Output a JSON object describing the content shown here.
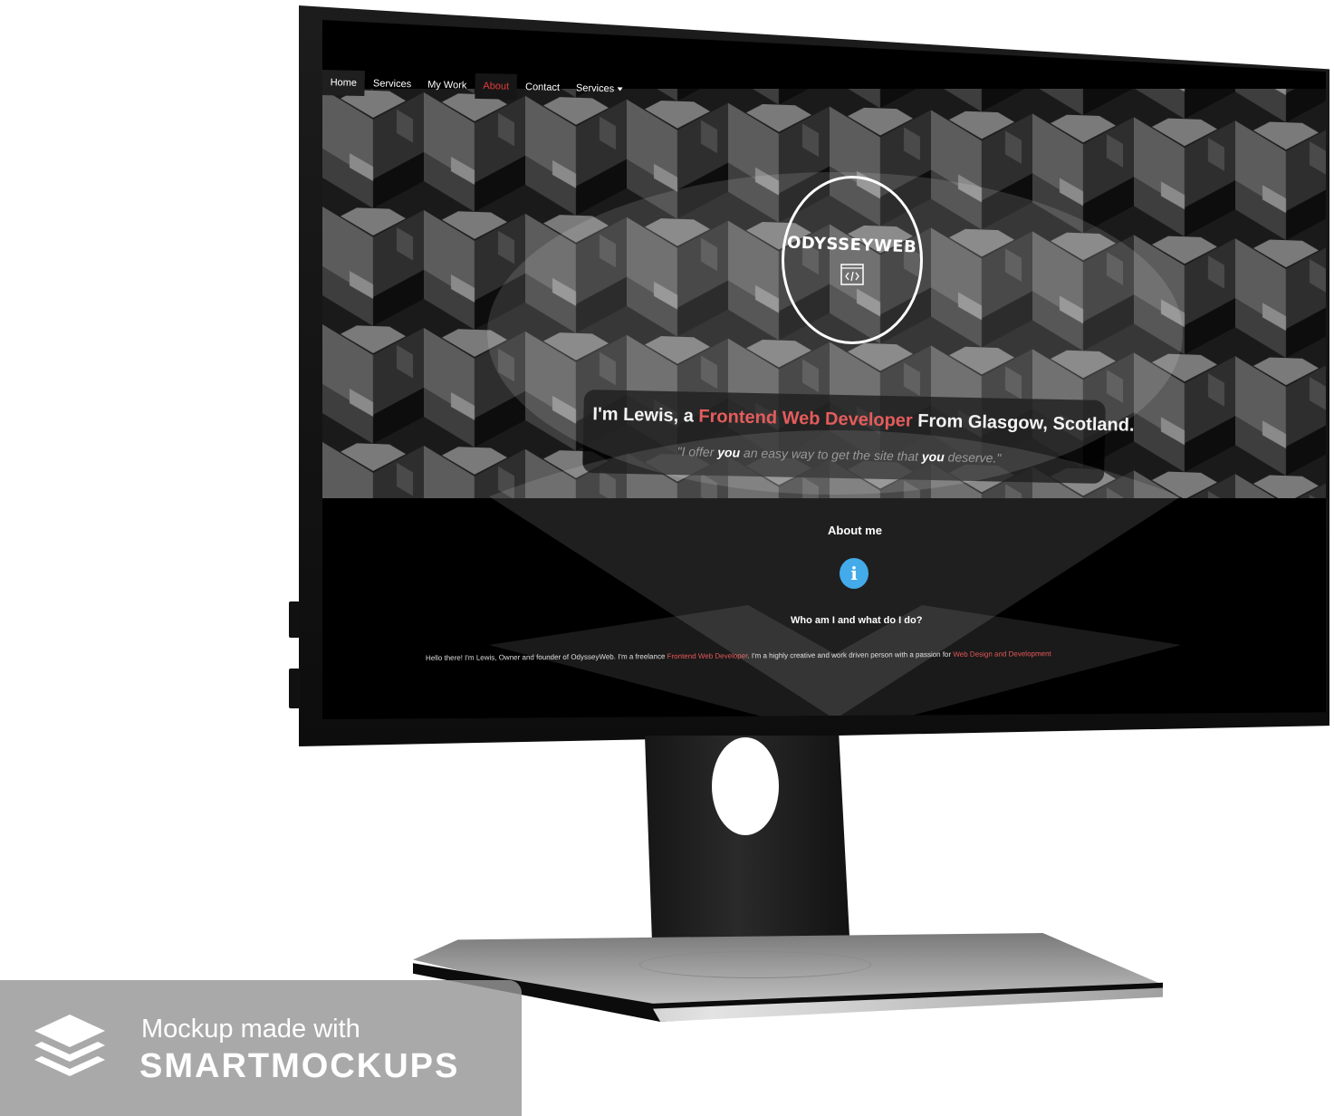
{
  "nav": {
    "items": [
      {
        "label": "Home"
      },
      {
        "label": "Services"
      },
      {
        "label": "My Work"
      },
      {
        "label": "About"
      },
      {
        "label": "Contact"
      },
      {
        "label": "Services"
      }
    ],
    "current_color": "#e23b3b"
  },
  "hero": {
    "logo_text": "ODYSSEYWEB",
    "logo_icon": "code-window-icon",
    "tagline": {
      "prefix": "I'm Lewis, a ",
      "highlight": "Frontend Web Developer",
      "suffix": " From Glasgow, Scotland."
    },
    "quote": {
      "part1": "\"I offer ",
      "you1": "you",
      "part2": " an easy way to get the site that ",
      "you2": "you",
      "part3": " deserve.\""
    }
  },
  "about": {
    "title": "About me",
    "icon": "info-icon",
    "subtitle": "Who am I and what do I do?",
    "intro": {
      "part1": "Hello there! I'm Lewis, Owner and founder of OdysseyWeb. I'm a freelance ",
      "highlight1": "Frontend Web Developer",
      "part2": ". I'm a highly creative and work driven person with a passion for ",
      "highlight2": "Web Design and Development"
    }
  },
  "watermark": {
    "line1": "Mockup made with",
    "line2": "SMARTMOCKUPS",
    "icon": "layers-icon"
  },
  "colors": {
    "accent_red": "#e24444",
    "info_blue": "#2aa0e6",
    "background": "#000000"
  }
}
